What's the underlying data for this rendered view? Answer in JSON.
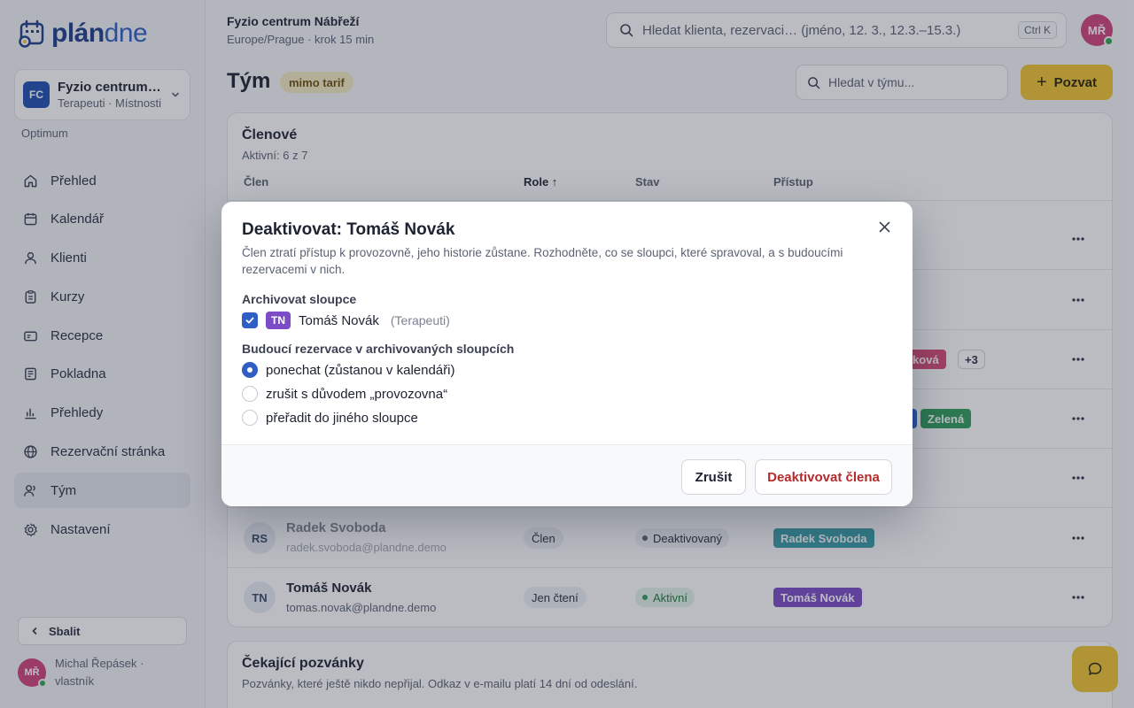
{
  "brand": {
    "logo_strong": "plán",
    "logo_light": "dne"
  },
  "workspace": {
    "badge": "FC",
    "name": "Fyzio centrum Nábřeží",
    "sub": "Terapeuti · Místnosti",
    "plan": "Optimum"
  },
  "nav": [
    {
      "label": "Přehled",
      "icon": "home-icon"
    },
    {
      "label": "Kalendář",
      "icon": "calendar-icon"
    },
    {
      "label": "Klienti",
      "icon": "user-icon"
    },
    {
      "label": "Kurzy",
      "icon": "clipboard-icon"
    },
    {
      "label": "Recepce",
      "icon": "reception-icon"
    },
    {
      "label": "Pokladna",
      "icon": "cash-register-icon"
    },
    {
      "label": "Přehledy",
      "icon": "bar-chart-icon"
    },
    {
      "label": "Rezervační stránka",
      "icon": "globe-icon"
    },
    {
      "label": "Tým",
      "icon": "team-icon",
      "active": true
    },
    {
      "label": "Nastavení",
      "icon": "gear-icon"
    }
  ],
  "sidebar_footer": {
    "collapse_label": "Sbalit",
    "user_initials": "MŘ",
    "user_label": "Michal Řepásek · vlastník"
  },
  "topbar": {
    "title": "Fyzio centrum Nábřeží",
    "subtitle": "Europe/Prague · krok 15 min",
    "search_placeholder": "Hledat klienta, rezervaci… (jméno, 12. 3., 12.3.–15.3.)",
    "shortcut": "Ctrl K",
    "avatar": "MŘ"
  },
  "page": {
    "title": "Tým",
    "badge": "mimo tarif",
    "team_search_placeholder": "Hledat v týmu...",
    "invite_label": "Pozvat"
  },
  "members_card": {
    "title": "Členové",
    "subtitle": "Aktivní: 6 z 7",
    "columns": {
      "member": "Člen",
      "role": "Role ↑",
      "status": "Stav",
      "access": "Přístup"
    },
    "visible_access_fragments": {
      "row3_tag": "rková",
      "row3_more": "+3",
      "row4_tag": "Zelená"
    },
    "rows": [
      {
        "initials": "RS",
        "name": "Radek Svoboda",
        "email": "radek.svoboda@plandne.demo",
        "role": "Člen",
        "status": "Deaktivovaný",
        "access": "Radek Svoboda",
        "active": false
      },
      {
        "initials": "TN",
        "name": "Tomáš Novák",
        "email": "tomas.novak@plandne.demo",
        "role": "Jen čtení",
        "status": "Aktivní",
        "access": "Tomáš Novák",
        "active": true
      }
    ]
  },
  "pending_card": {
    "title": "Čekající pozvánky",
    "subtitle": "Pozvánky, které ještě nikdo nepřijal. Odkaz v e-mailu platí 14 dní od odeslání."
  },
  "colors": {
    "accent": "#2f5fc4",
    "brand_yellow": "#f2c531",
    "danger": "#b52a2a",
    "tag_purple": "#7b4cc6",
    "tag_teal": "#3aa0a8",
    "tag_green": "#2f9c5a",
    "tag_pink": "#d84a72"
  },
  "modal": {
    "title": "Deaktivovat: Tomáš Novák",
    "description": "Člen ztratí přístup k provozovně, jeho historie zůstane. Rozhodněte, co se sloupci, které spravoval, a s budoucími rezervacemi v nich.",
    "archive_label": "Archivovat sloupce",
    "archive_item": {
      "tag": "TN",
      "name": "Tomáš Novák",
      "team": "(Terapeuti)",
      "checked": true
    },
    "future_label": "Budoucí rezervace v archivovaných sloupcích",
    "options": [
      {
        "label": "ponechat (zůstanou v kalendáři)",
        "selected": true
      },
      {
        "label": "zrušit s důvodem „provozovna“",
        "selected": false
      },
      {
        "label": "přeřadit do jiného sloupce",
        "selected": false
      }
    ],
    "cancel_label": "Zrušit",
    "confirm_label": "Deaktivovat člena"
  }
}
